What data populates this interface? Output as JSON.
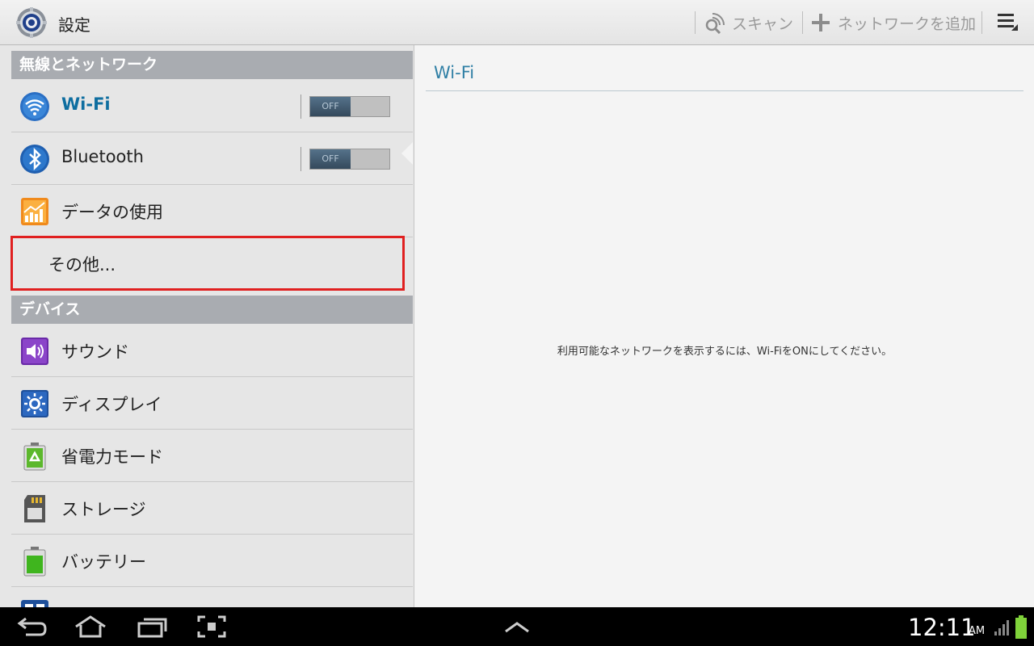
{
  "app": {
    "title": "設定"
  },
  "actionbar": {
    "scan_label": "スキャン",
    "add_network_label": "ネットワークを追加"
  },
  "sidebar": {
    "sections": [
      {
        "header": "無線とネットワーク"
      },
      {
        "header": "デバイス"
      }
    ],
    "items": [
      {
        "label": "Wi-Fi",
        "icon": "wifi-icon",
        "toggle": "OFF"
      },
      {
        "label": "Bluetooth",
        "icon": "bluetooth-icon",
        "toggle": "OFF"
      },
      {
        "label": "データの使用",
        "icon": "data-usage-icon"
      },
      {
        "label": "その他..."
      },
      {
        "label": "サウンド",
        "icon": "sound-icon"
      },
      {
        "label": "ディスプレイ",
        "icon": "display-icon"
      },
      {
        "label": "省電力モード",
        "icon": "power-saving-icon"
      },
      {
        "label": "ストレージ",
        "icon": "storage-icon"
      },
      {
        "label": "バッテリー",
        "icon": "battery-icon"
      }
    ]
  },
  "detail": {
    "title": "Wi-Fi",
    "message": "利用可能なネットワークを表示するには、Wi-FiをONにしてください。"
  },
  "statusbar": {
    "time": "12:11",
    "ampm": "AM"
  },
  "colors": {
    "accent": "#0e6ea0",
    "section_header": "#a9acb1",
    "highlight": "#e02020"
  }
}
